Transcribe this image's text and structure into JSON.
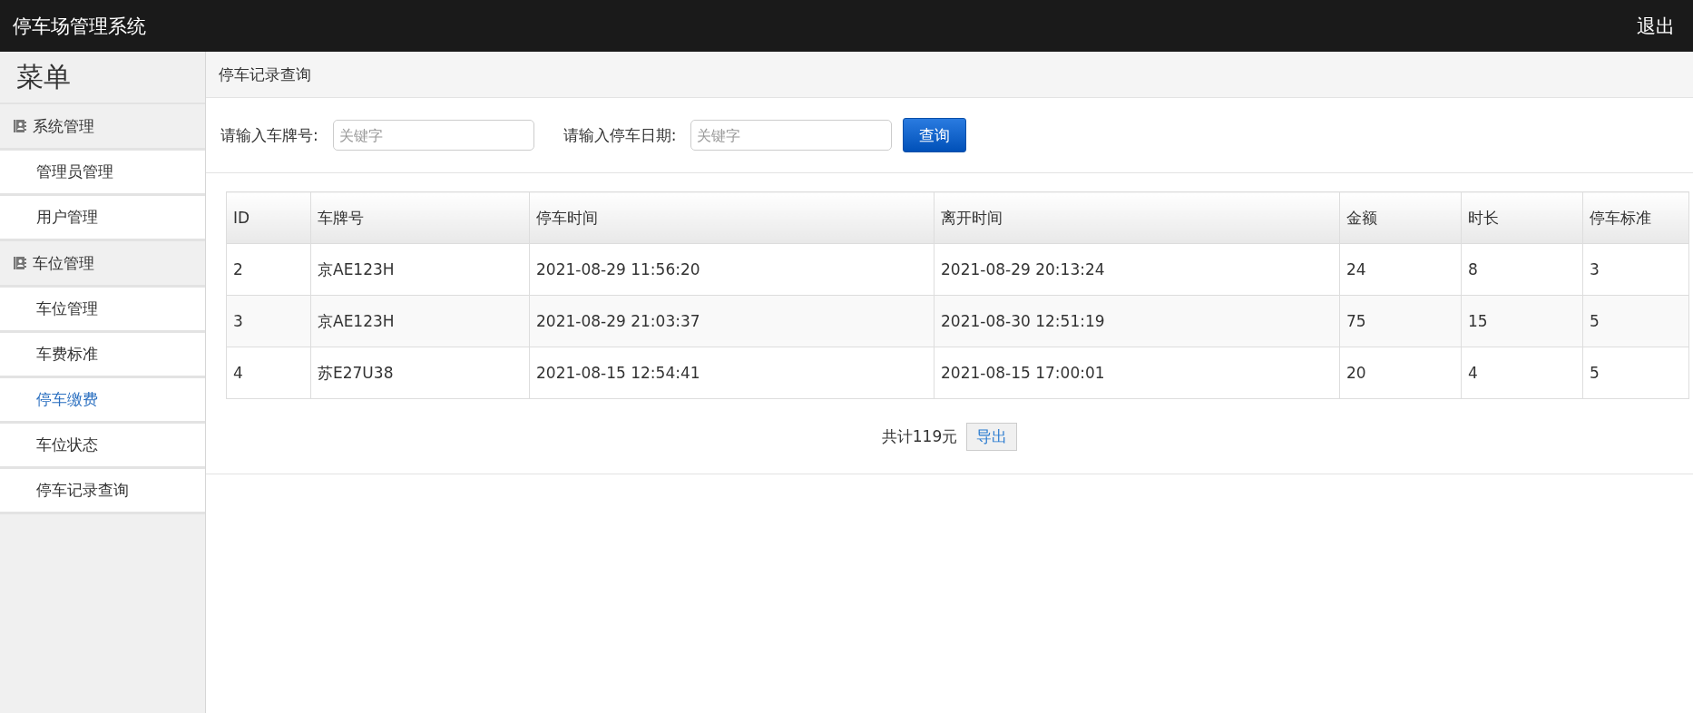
{
  "header": {
    "title": "停车场管理系统",
    "logout": "退出"
  },
  "sidebar": {
    "title": "菜单",
    "groups": [
      {
        "label": "系统管理",
        "children": [
          {
            "label": "管理员管理",
            "selected": false
          },
          {
            "label": "用户管理",
            "selected": false
          }
        ]
      },
      {
        "label": "车位管理",
        "children": [
          {
            "label": "车位管理",
            "selected": false
          },
          {
            "label": "车费标准",
            "selected": false
          },
          {
            "label": "停车缴费",
            "selected": true
          },
          {
            "label": "车位状态",
            "selected": false
          },
          {
            "label": "停车记录查询",
            "selected": false
          }
        ]
      }
    ]
  },
  "breadcrumb": "停车记录查询",
  "search": {
    "fields": [
      {
        "label": "请输入车牌号:",
        "placeholder": "关键字"
      },
      {
        "label": "请输入停车日期:",
        "placeholder": "关键字"
      }
    ],
    "button": "查询"
  },
  "table": {
    "columns": [
      "ID",
      "车牌号",
      "停车时间",
      "离开时间",
      "金额",
      "时长",
      "停车标准"
    ],
    "rows": [
      [
        "2",
        "京AE123H",
        "2021-08-29 11:56:20",
        "2021-08-29 20:13:24",
        "24",
        "8",
        "3"
      ],
      [
        "3",
        "京AE123H",
        "2021-08-29 21:03:37",
        "2021-08-30 12:51:19",
        "75",
        "15",
        "5"
      ],
      [
        "4",
        "苏E27U38",
        "2021-08-15 12:54:41",
        "2021-08-15 17:00:01",
        "20",
        "4",
        "5"
      ]
    ]
  },
  "summary": {
    "total": "共计119元",
    "export": "导出"
  }
}
